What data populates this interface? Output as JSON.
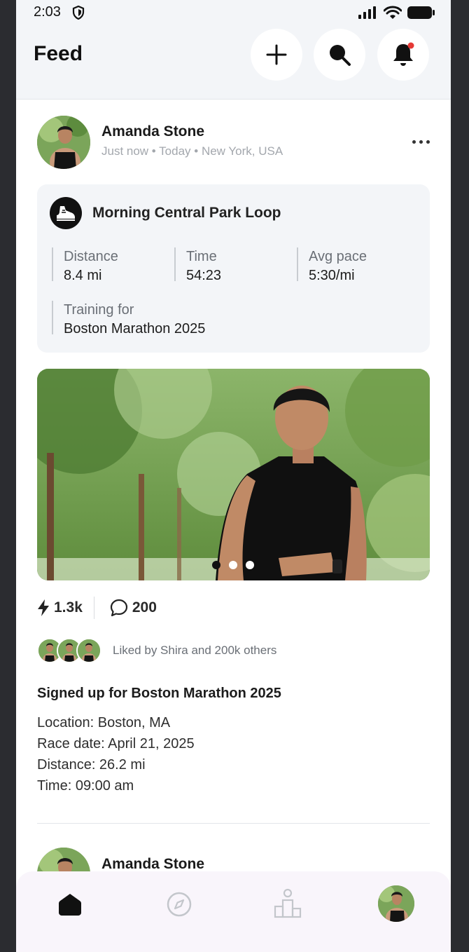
{
  "status_bar": {
    "time": "2:03"
  },
  "header": {
    "title": "Feed"
  },
  "post": {
    "author": "Amanda Stone",
    "meta": "Just now • Today • New York, USA",
    "activity": {
      "title": "Morning Central Park Loop",
      "stats": [
        {
          "label": "Distance",
          "value": "8.4 mi"
        },
        {
          "label": "Time",
          "value": "54:23"
        },
        {
          "label": "Avg pace",
          "value": "5:30/mi"
        }
      ],
      "training_label": "Training for",
      "training_value": "Boston Marathon 2025"
    },
    "carousel": {
      "total": 3,
      "active": 1
    },
    "kudos_count": "1.3k",
    "comment_count": "200",
    "liked_by": "Liked by Shira and 200k others",
    "headline": "Signed up for Boston Marathon 2025",
    "details": [
      "Location: Boston, MA",
      "Race date: April 21, 2025",
      "Distance: 26.2 mi",
      "Time: 09:00 am"
    ]
  },
  "next_post": {
    "author": "Amanda Stone"
  },
  "colors": {
    "accent_notification": "#e53935",
    "card_bg": "#f3f5f8",
    "nav_bg": "#f9f5fb"
  }
}
